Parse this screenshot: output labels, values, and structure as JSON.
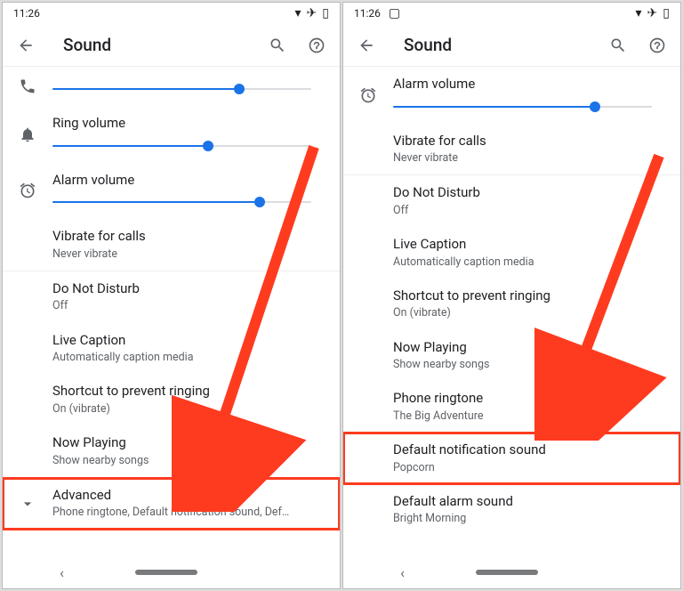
{
  "left": {
    "status": {
      "time": "11:26"
    },
    "appbar": {
      "title": "Sound"
    },
    "sliders": {
      "call": {
        "label": "",
        "value": 72
      },
      "ring": {
        "label": "Ring volume",
        "value": 60
      },
      "alarm": {
        "label": "Alarm volume",
        "value": 80
      }
    },
    "items": {
      "vibrate": {
        "label": "Vibrate for calls",
        "sub": "Never vibrate"
      },
      "dnd": {
        "label": "Do Not Disturb",
        "sub": "Off"
      },
      "caption": {
        "label": "Live Caption",
        "sub": "Automatically caption media"
      },
      "shortcut": {
        "label": "Shortcut to prevent ringing",
        "sub": "On (vibrate)"
      },
      "nowplaying": {
        "label": "Now Playing",
        "sub": "Show nearby songs"
      },
      "advanced": {
        "label": "Advanced",
        "sub": "Phone ringtone, Default notification sound, Def…"
      }
    }
  },
  "right": {
    "status": {
      "time": "11:26"
    },
    "appbar": {
      "title": "Sound"
    },
    "sliders": {
      "alarm": {
        "label": "Alarm volume",
        "value": 78
      }
    },
    "items": {
      "vibrate": {
        "label": "Vibrate for calls",
        "sub": "Never vibrate"
      },
      "dnd": {
        "label": "Do Not Disturb",
        "sub": "Off"
      },
      "caption": {
        "label": "Live Caption",
        "sub": "Automatically caption media"
      },
      "shortcut": {
        "label": "Shortcut to prevent ringing",
        "sub": "On (vibrate)"
      },
      "nowplaying": {
        "label": "Now Playing",
        "sub": "Show nearby songs"
      },
      "ringtone": {
        "label": "Phone ringtone",
        "sub": "The Big Adventure"
      },
      "defnotif": {
        "label": "Default notification sound",
        "sub": "Popcorn"
      },
      "defalarm": {
        "label": "Default alarm sound",
        "sub": "Bright Morning"
      }
    }
  },
  "colors": {
    "accent": "#1a73e8",
    "highlight": "#ff3b1f"
  }
}
